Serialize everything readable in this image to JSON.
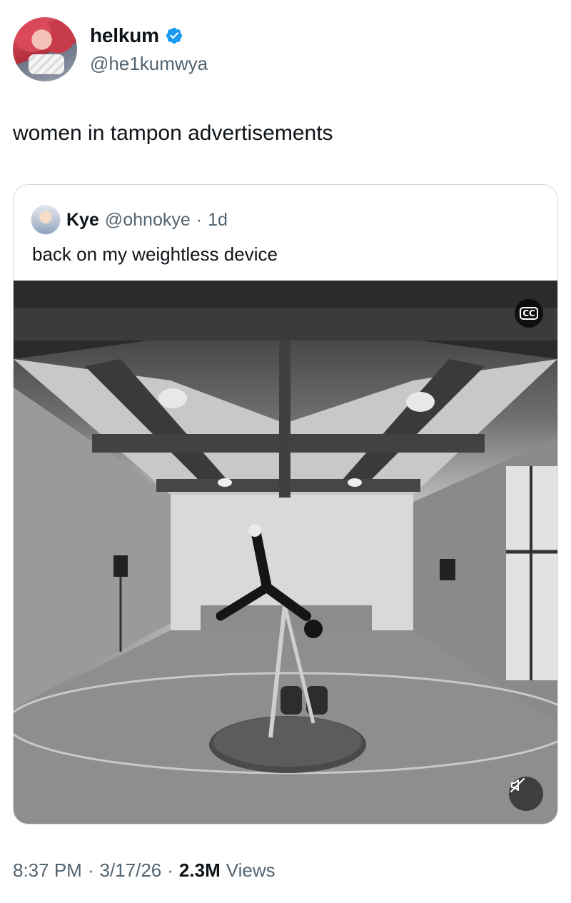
{
  "author": {
    "display_name": "helkum",
    "handle": "@he1kumwya",
    "verified": true,
    "avatar_icon": "anime-avatar"
  },
  "tweet": {
    "text": "women in tampon advertisements"
  },
  "quoted_tweet": {
    "display_name": "Kye",
    "handle": "@ohnokye",
    "separator": "·",
    "age": "1d",
    "text": "back on my weightless device",
    "media": {
      "type": "video",
      "captions_label": "CC",
      "mute_icon": "speaker-muted-icon"
    }
  },
  "footer": {
    "time": "8:37 PM",
    "sep1": "·",
    "date": "3/17/26",
    "sep2": "·",
    "views_count": "2.3M",
    "views_label": "Views"
  },
  "colors": {
    "verified": "#1d9bf0",
    "secondary_text": "#536471",
    "border": "#cfd9de"
  }
}
